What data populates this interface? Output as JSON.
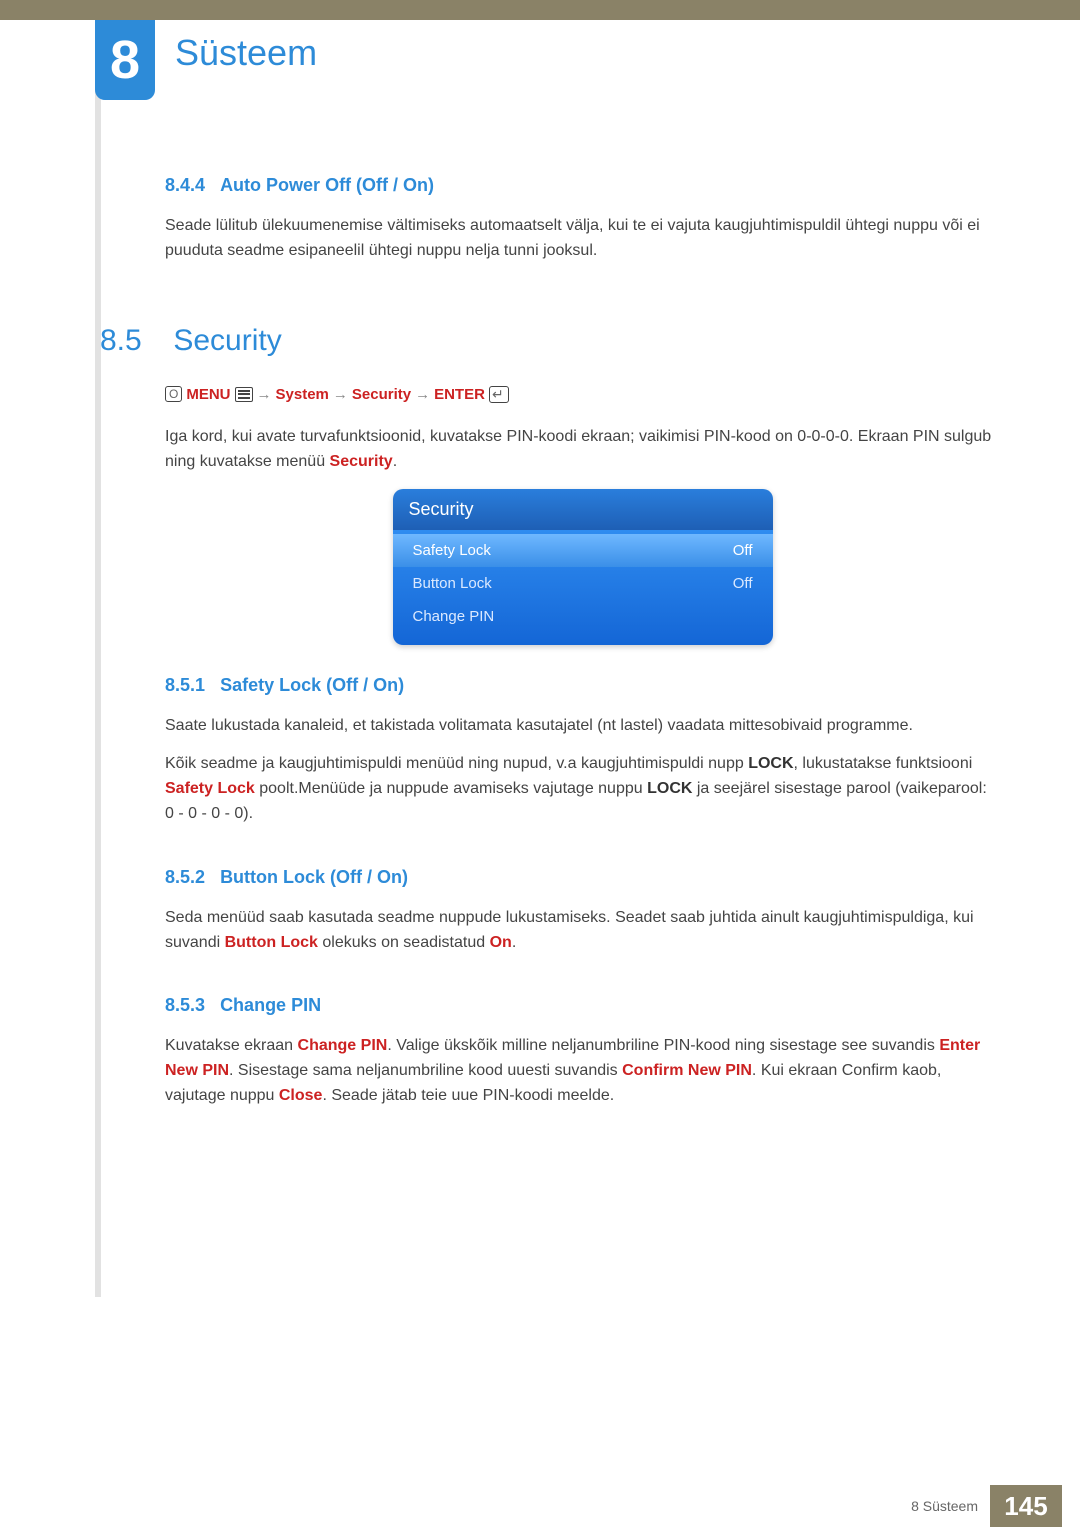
{
  "chapter": {
    "number": "8",
    "title": "Süsteem"
  },
  "sec844": {
    "num": "8.4.4",
    "title": "Auto Power Off (Off / On)",
    "p1": "Seade lülitub ülekuumenemise vältimiseks automaatselt välja, kui te ei vajuta kaugjuhtimispuldil ühtegi nuppu või ei puuduta seadme esipaneelil ühtegi nuppu nelja tunni jooksul."
  },
  "sec85": {
    "num": "8.5",
    "title": "Security",
    "nav": {
      "menu": "MENU",
      "system": "System",
      "security": "Security",
      "enter": "ENTER",
      "arrow": "→"
    },
    "p1a": "Iga kord, kui avate turvafunktsioonid, kuvatakse PIN-koodi ekraan; vaikimisi PIN-kood on 0-0-0-0. Ekraan PIN sulgub ning kuvatakse menüü ",
    "p1_security": "Security",
    "p1b": "."
  },
  "osd": {
    "title": "Security",
    "rows": [
      {
        "label": "Safety Lock",
        "value": "Off",
        "selected": true
      },
      {
        "label": "Button Lock",
        "value": "Off",
        "selected": false
      },
      {
        "label": "Change PIN",
        "value": "",
        "selected": false
      }
    ]
  },
  "sec851": {
    "num": "8.5.1",
    "title": "Safety Lock (Off / On)",
    "p1": "Saate lukustada kanaleid, et takistada volitamata kasutajatel (nt lastel) vaadata mittesobivaid programme.",
    "p2a": "Kõik seadme ja kaugjuhtimispuldi menüüd ning nupud, v.a kaugjuhtimispuldi nupp ",
    "p2_lock1": "LOCK",
    "p2b": ", lukustatakse funktsiooni ",
    "p2_safety": "Safety Lock",
    "p2c": " poolt.Menüüde ja nuppude avamiseks vajutage nuppu ",
    "p2_lock2": "LOCK",
    "p2d": "  ja seejärel sisestage parool (vaikeparool: 0 - 0 - 0 - 0)."
  },
  "sec852": {
    "num": "8.5.2",
    "title": "Button Lock (Off / On)",
    "p1a": "Seda menüüd saab kasutada seadme nuppude lukustamiseks. Seadet saab juhtida ainult kaugjuhtimispuldiga, kui suvandi ",
    "p1_button": "Button Lock",
    "p1b": " olekuks on seadistatud ",
    "p1_on": "On",
    "p1c": "."
  },
  "sec853": {
    "num": "8.5.3",
    "title": "Change PIN",
    "p1a": "Kuvatakse ekraan ",
    "p1_change": "Change PIN",
    "p1b": ". Valige ükskõik milline neljanumbriline PIN-kood ning sisestage see suvandis ",
    "p1_enter": "Enter New PIN",
    "p1c": ". Sisestage sama neljanumbriline kood uuesti suvandis ",
    "p1_confirm": "Confirm New PIN",
    "p1d": ". Kui ekraan Confirm kaob, vajutage nuppu ",
    "p1_close": "Close",
    "p1e": ". Seade jätab teie uue PIN-koodi meelde."
  },
  "footer": {
    "text": "8 Süsteem",
    "page": "145"
  }
}
